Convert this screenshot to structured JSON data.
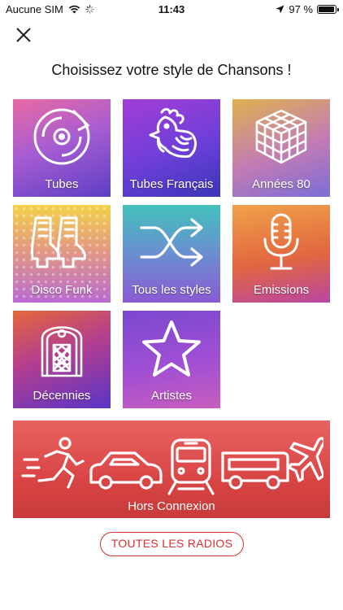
{
  "status_bar": {
    "carrier": "Aucune SIM",
    "time": "11:43",
    "battery": "97 %",
    "battery_level": 0.97,
    "icons": [
      "wifi-icon",
      "activity-spinner-icon",
      "location-arrow-icon",
      "battery-icon"
    ]
  },
  "header": {
    "close_icon": "close-icon",
    "title": "Choisissez votre style de Chansons !"
  },
  "categories": [
    {
      "label": "Tubes",
      "icon": "vinyl-record-icon"
    },
    {
      "label": "Tubes Français",
      "icon": "rooster-icon"
    },
    {
      "label": "Années 80",
      "icon": "rubiks-cube-icon"
    },
    {
      "label": "Disco Funk",
      "icon": "platform-boots-icon"
    },
    {
      "label": "Tous les styles",
      "icon": "shuffle-icon"
    },
    {
      "label": "Emissions",
      "icon": "microphone-icon"
    },
    {
      "label": "Décennies",
      "icon": "jukebox-icon"
    },
    {
      "label": "Artistes",
      "icon": "star-icon"
    }
  ],
  "offline": {
    "label": "Hors Connexion",
    "icons": [
      "running-person-icon",
      "car-icon",
      "train-icon",
      "bus-icon",
      "airplane-icon"
    ]
  },
  "all_radios_button": "TOUTES LES RADIOS",
  "colors": {
    "accent_red": "#d7302f",
    "offline_tile": "#d94545"
  }
}
